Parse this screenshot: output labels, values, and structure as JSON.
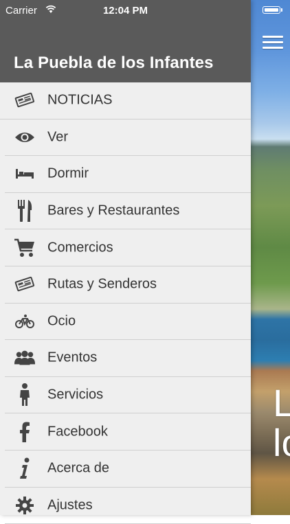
{
  "status_bar": {
    "carrier": "Carrier",
    "time": "12:04 PM"
  },
  "app": {
    "title": "La Puebla de los Infantes"
  },
  "background": {
    "overlay_text": "L\nlo"
  },
  "menu": {
    "items": [
      {
        "label": "NOTICIAS",
        "icon": "newspaper-icon"
      },
      {
        "label": "Ver",
        "icon": "eye-icon"
      },
      {
        "label": "Dormir",
        "icon": "bed-icon"
      },
      {
        "label": "Bares y Restaurantes",
        "icon": "fork-knife-icon"
      },
      {
        "label": "Comercios",
        "icon": "shopping-cart-icon"
      },
      {
        "label": "Rutas y Senderos",
        "icon": "newspaper-icon"
      },
      {
        "label": "Ocio",
        "icon": "bicycle-icon"
      },
      {
        "label": "Eventos",
        "icon": "group-icon"
      },
      {
        "label": "Servicios",
        "icon": "person-icon"
      },
      {
        "label": "Facebook",
        "icon": "facebook-icon"
      },
      {
        "label": "Acerca de",
        "icon": "info-icon"
      },
      {
        "label": "Ajustes",
        "icon": "gear-icon"
      }
    ]
  },
  "colors": {
    "header_bg": "#5a5a5a",
    "drawer_bg": "#efefef",
    "text": "#333333"
  }
}
